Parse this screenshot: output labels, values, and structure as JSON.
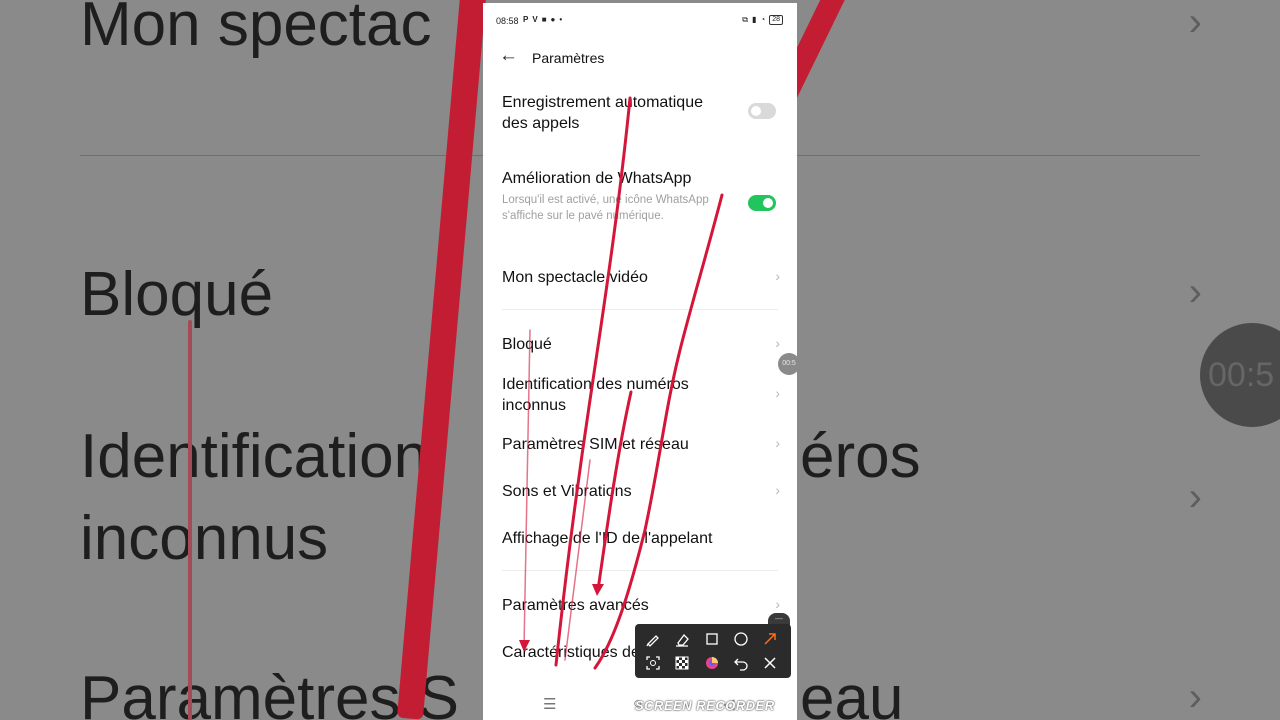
{
  "background": {
    "texts": [
      "Mon spectac",
      "Bloqué",
      "Identification",
      "éros",
      "inconnus",
      "Paramètres S",
      "eau"
    ],
    "timer": "00:5"
  },
  "status": {
    "time": "08:58",
    "left_icons": [
      "P",
      "V",
      "■",
      "●",
      "•"
    ],
    "right_icons": [
      "cast-icon",
      "signal-icon",
      "wifi-icon"
    ],
    "battery": "28"
  },
  "header": {
    "back_icon": "←",
    "title": "Paramètres"
  },
  "settings": [
    {
      "label": "Enregistrement automatique des appels",
      "toggle": "off"
    },
    {
      "label": "Amélioration de WhatsApp",
      "description": "Lorsqu'il est activé, une icône WhatsApp s'affiche sur le pavé numérique.",
      "toggle": "on"
    },
    {
      "label": "Mon spectacle vidéo"
    },
    {
      "label": "Bloqué"
    },
    {
      "label": "Identification des numéros inconnus"
    },
    {
      "label": "Paramètres SIM et réseau"
    },
    {
      "label": "Sons et Vibrations"
    },
    {
      "label": "Affichage de l'ID de l'appelant"
    },
    {
      "label": "Paramètres avancés"
    },
    {
      "label": "Caractéristiques de l'opérateur"
    }
  ],
  "chevron": "›",
  "recorder": {
    "bubble_time": "00:5",
    "watermark": "SCREEN RECORDER"
  },
  "navbar": {
    "menu": "☰",
    "home": "○",
    "back": "◁"
  },
  "annotation_tools": [
    "pen-icon",
    "eraser-icon",
    "rectangle-icon",
    "circle-icon",
    "arrow-icon",
    "screenshot-icon",
    "mosaic-icon",
    "color-icon",
    "undo-icon",
    "close-icon"
  ],
  "colors": {
    "toggle_on": "#21c45d",
    "annotation_red": "#d4163a",
    "arrow_tool": "#ff6a1a"
  }
}
